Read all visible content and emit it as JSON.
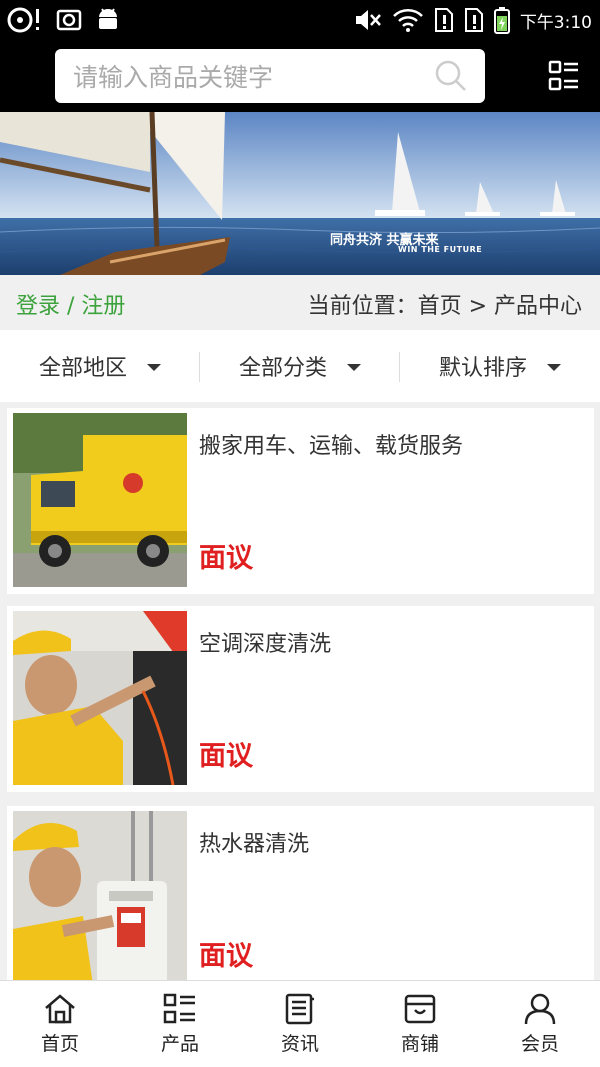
{
  "status_bar": {
    "time": "下午3:10"
  },
  "search": {
    "placeholder": "请输入商品关键字"
  },
  "banner": {
    "caption": "同舟共济  共赢未来",
    "caption_en": "WIN THE FUTURE"
  },
  "location": {
    "login_label": "登录 / 注册",
    "breadcrumb": "当前位置：首页 > 产品中心"
  },
  "filters": [
    {
      "label": "全部地区"
    },
    {
      "label": "全部分类"
    },
    {
      "label": "默认排序"
    }
  ],
  "products": [
    {
      "title": "搬家用车、运输、载货服务",
      "price": "面议",
      "image": "yellow-truck"
    },
    {
      "title": "空调深度清洗",
      "price": "面议",
      "image": "ac-cleaning-worker"
    },
    {
      "title": "热水器清洗",
      "price": "面议",
      "image": "water-heater-worker"
    }
  ],
  "tabs": [
    {
      "label": "首页",
      "icon": "home-icon"
    },
    {
      "label": "产品",
      "icon": "grid-list-icon"
    },
    {
      "label": "资讯",
      "icon": "news-icon"
    },
    {
      "label": "商铺",
      "icon": "shop-icon"
    },
    {
      "label": "会员",
      "icon": "user-icon"
    }
  ],
  "colors": {
    "accent_green": "#3ca23c",
    "price_red": "#e02020",
    "header_bg": "#000000"
  }
}
